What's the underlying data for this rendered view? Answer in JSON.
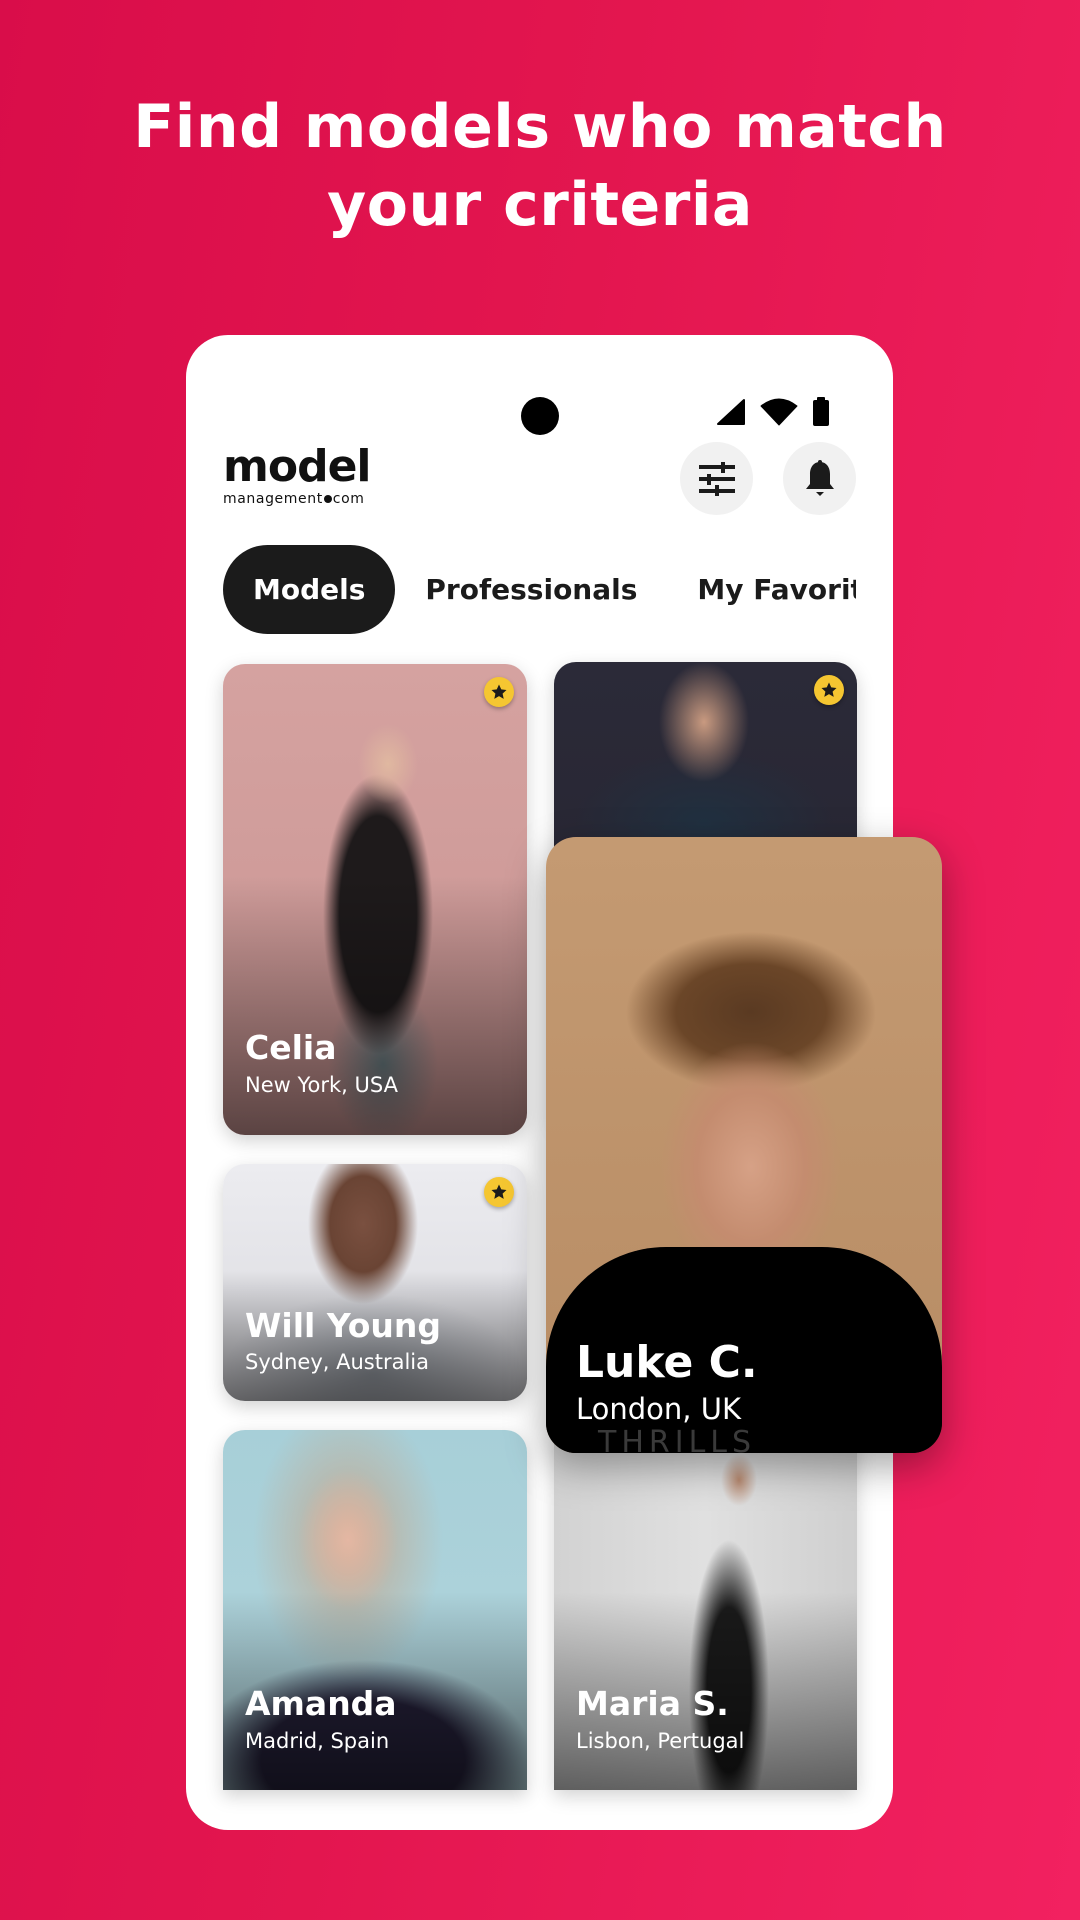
{
  "headline": {
    "line1": "Find models who match",
    "line2": "your criteria"
  },
  "colors": {
    "background_start": "#d90d4a",
    "background_end": "#f22160",
    "dark": "#1b1b1b",
    "star_badge": "#f5c631",
    "icon_button_bg": "#f1f1f1"
  },
  "status_bar": {
    "icons": [
      "signal-icon",
      "wifi-icon",
      "battery-icon"
    ]
  },
  "app": {
    "logo_main": "model",
    "logo_sub_left": "management",
    "logo_sub_right": "com",
    "actions": [
      {
        "icon": "filter-sliders-icon",
        "label": "Filters"
      },
      {
        "icon": "bell-icon",
        "label": "Notifications"
      }
    ]
  },
  "tabs": [
    {
      "label": "Models",
      "active": true
    },
    {
      "label": "Professionals",
      "active": false
    },
    {
      "label": "My Favorites",
      "active": false
    }
  ],
  "cards": [
    {
      "name": "Celia",
      "location": "New York, USA",
      "favorite": true
    },
    {
      "name": "",
      "location": "",
      "favorite": true
    },
    {
      "name": "Will Young",
      "location": "Sydney, Australia",
      "favorite": true
    },
    {
      "name": "Amanda",
      "location": "Madrid, Spain",
      "favorite": false
    },
    {
      "name": "Maria S.",
      "location": "Lisbon, Pertugal",
      "favorite": false
    }
  ],
  "featured_card": {
    "name": "Luke C.",
    "location": "London, UK",
    "shirt_text": "THRILLS COMPANY"
  }
}
